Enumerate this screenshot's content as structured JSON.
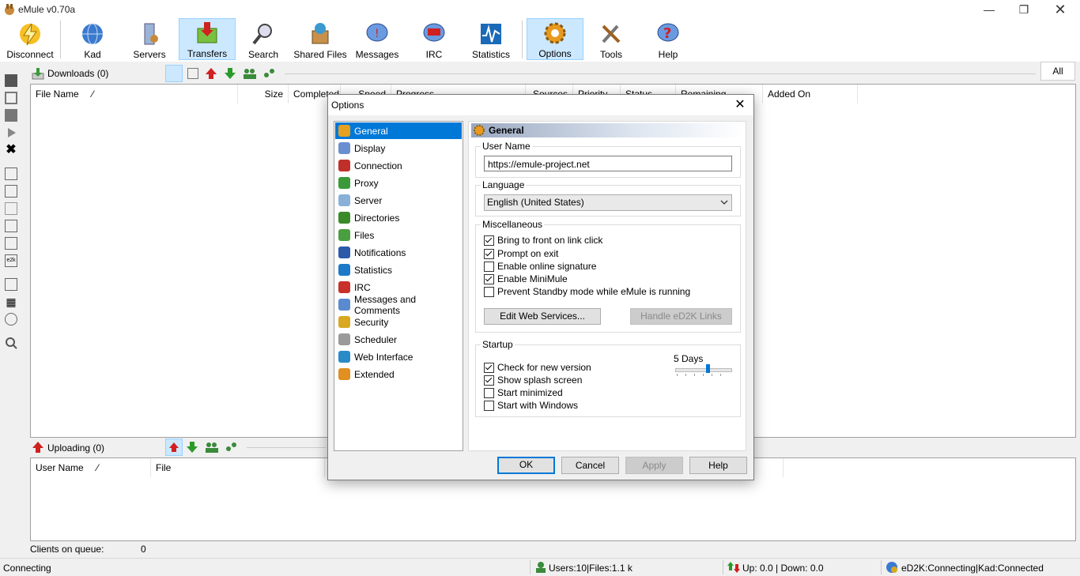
{
  "window": {
    "title": "eMule v0.70a"
  },
  "toolbar": {
    "buttons": [
      {
        "label": "Disconnect"
      },
      {
        "label": "Kad"
      },
      {
        "label": "Servers"
      },
      {
        "label": "Transfers"
      },
      {
        "label": "Search"
      },
      {
        "label": "Shared Files"
      },
      {
        "label": "Messages"
      },
      {
        "label": "IRC"
      },
      {
        "label": "Statistics"
      },
      {
        "label": "Options"
      },
      {
        "label": "Tools"
      },
      {
        "label": "Help"
      }
    ],
    "all_button": "All"
  },
  "downloads": {
    "title": "Downloads (0)",
    "columns": [
      "File Name",
      "Size",
      "Completed",
      "Speed",
      "Progress",
      "Sources",
      "Priority",
      "Status",
      "Remaining",
      "Added On"
    ]
  },
  "uploads": {
    "title": "Uploading (0)",
    "columns": [
      "User Name",
      "File"
    ],
    "queue_label": "Clients on queue:",
    "queue_count": "0"
  },
  "statusbar": {
    "status": "Connecting",
    "users": "Users:10|Files:1.1 k",
    "traffic": "Up: 0.0 | Down: 0.0",
    "network": "eD2K:Connecting|Kad:Connected"
  },
  "dialog": {
    "title": "Options",
    "nav": [
      {
        "label": "General",
        "color": "#e8a020"
      },
      {
        "label": "Display",
        "color": "#6a8fd0"
      },
      {
        "label": "Connection",
        "color": "#c0302a"
      },
      {
        "label": "Proxy",
        "color": "#3a9a3a"
      },
      {
        "label": "Server",
        "color": "#8ab0d8"
      },
      {
        "label": "Directories",
        "color": "#3a8a2a"
      },
      {
        "label": "Files",
        "color": "#4aa040"
      },
      {
        "label": "Notifications",
        "color": "#2a5aa8"
      },
      {
        "label": "Statistics",
        "color": "#1e7ac8"
      },
      {
        "label": "IRC",
        "color": "#c8302a"
      },
      {
        "label": "Messages and Comments",
        "color": "#5a8ad0"
      },
      {
        "label": "Security",
        "color": "#d8a820"
      },
      {
        "label": "Scheduler",
        "color": "#9a9a9a"
      },
      {
        "label": "Web Interface",
        "color": "#2a8ac8"
      },
      {
        "label": "Extended",
        "color": "#e09020"
      }
    ],
    "pane_title": "General",
    "username_label": "User Name",
    "username_value": "https://emule-project.net",
    "language_label": "Language",
    "language_value": "English (United States)",
    "misc_label": "Miscellaneous",
    "misc": [
      {
        "label": "Bring to front on link click",
        "checked": true
      },
      {
        "label": "Prompt on exit",
        "checked": true
      },
      {
        "label": "Enable online signature",
        "checked": false
      },
      {
        "label": "Enable MiniMule",
        "checked": true
      },
      {
        "label": "Prevent Standby mode while eMule is running",
        "checked": false
      }
    ],
    "edit_web_services": "Edit Web Services...",
    "handle_ed2k": "Handle eD2K Links",
    "startup_label": "Startup",
    "startup_days": "5 Days",
    "startup": [
      {
        "label": "Check for new version",
        "checked": true
      },
      {
        "label": "Show splash screen",
        "checked": true
      },
      {
        "label": "Start minimized",
        "checked": false
      },
      {
        "label": "Start with Windows",
        "checked": false
      }
    ],
    "buttons": {
      "ok": "OK",
      "cancel": "Cancel",
      "apply": "Apply",
      "help": "Help"
    }
  }
}
